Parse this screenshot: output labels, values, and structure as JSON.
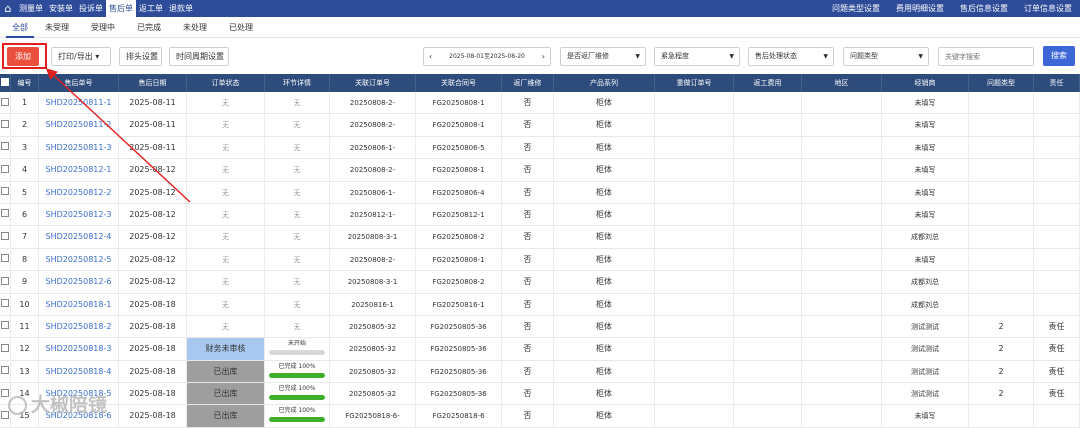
{
  "topnav": {
    "items": [
      "测量单",
      "安装单",
      "投诉单",
      "售后单",
      "返工单",
      "退款单"
    ],
    "active_index": 3,
    "right": [
      "问题类型设置",
      "费用明细设置",
      "售后信息设置",
      "订单信息设置"
    ]
  },
  "status_tabs": [
    "全部",
    "未受理",
    "受理中",
    "已完成",
    "未处理",
    "已处理"
  ],
  "toolbar": {
    "add": "添加",
    "print": "打印/导出",
    "col_setting": "排头设置",
    "time_setting": "时间周期设置",
    "date_range": "2025-08-01至2025-08-20",
    "filters": [
      "是否返厂维修",
      "紧急程度",
      "售后处理状态",
      "问题类型"
    ],
    "search_placeholder": "关键字搜索",
    "search_btn": "搜索"
  },
  "table": {
    "headers": [
      "编号",
      "售后单号",
      "售后日期",
      "订单状态",
      "环节详情",
      "关联订单号",
      "关联合同号",
      "返厂维修",
      "产品系列",
      "重做订单号",
      "返工费用",
      "地区",
      "经销商",
      "问题类型",
      "责任"
    ],
    "rows": [
      {
        "no": "1",
        "code": "SHD20250811-1",
        "date": "2025-08-11",
        "status": "无",
        "detail": "无",
        "order": "20250808-2-",
        "contract": "FG20250808-1",
        "ret": "否",
        "series": "柜体",
        "dealer": "未填写",
        "issue": "",
        "resp": ""
      },
      {
        "no": "2",
        "code": "SHD20250811-2",
        "date": "2025-08-11",
        "status": "无",
        "detail": "无",
        "order": "20250808-2-",
        "contract": "FG20250808-1",
        "ret": "否",
        "series": "柜体",
        "dealer": "未填写",
        "issue": "",
        "resp": ""
      },
      {
        "no": "3",
        "code": "SHD20250811-3",
        "date": "2025-08-11",
        "status": "无",
        "detail": "无",
        "order": "20250806-1-",
        "contract": "FG20250806-5",
        "ret": "否",
        "series": "柜体",
        "dealer": "未填写",
        "issue": "",
        "resp": ""
      },
      {
        "no": "4",
        "code": "SHD20250812-1",
        "date": "2025-08-12",
        "status": "无",
        "detail": "无",
        "order": "20250808-2-",
        "contract": "FG20250808-1",
        "ret": "否",
        "series": "柜体",
        "dealer": "未填写",
        "issue": "",
        "resp": ""
      },
      {
        "no": "5",
        "code": "SHD20250812-2",
        "date": "2025-08-12",
        "status": "无",
        "detail": "无",
        "order": "20250806-1-",
        "contract": "FG20250806-4",
        "ret": "否",
        "series": "柜体",
        "dealer": "未填写",
        "issue": "",
        "resp": ""
      },
      {
        "no": "6",
        "code": "SHD20250812-3",
        "date": "2025-08-12",
        "status": "无",
        "detail": "无",
        "order": "20250812-1-",
        "contract": "FG20250812-1",
        "ret": "否",
        "series": "柜体",
        "dealer": "未填写",
        "issue": "",
        "resp": ""
      },
      {
        "no": "7",
        "code": "SHD20250812-4",
        "date": "2025-08-12",
        "status": "无",
        "detail": "无",
        "order": "20250808-3-1",
        "contract": "FG20250808-2",
        "ret": "否",
        "series": "柜体",
        "dealer": "成都刘总",
        "issue": "",
        "resp": ""
      },
      {
        "no": "8",
        "code": "SHD20250812-5",
        "date": "2025-08-12",
        "status": "无",
        "detail": "无",
        "order": "20250808-2-",
        "contract": "FG20250808-1",
        "ret": "否",
        "series": "柜体",
        "dealer": "未填写",
        "issue": "",
        "resp": ""
      },
      {
        "no": "9",
        "code": "SHD20250812-6",
        "date": "2025-08-12",
        "status": "无",
        "detail": "无",
        "order": "20250808-3-1",
        "contract": "FG20250808-2",
        "ret": "否",
        "series": "柜体",
        "dealer": "成都刘总",
        "issue": "",
        "resp": ""
      },
      {
        "no": "10",
        "code": "SHD20250818-1",
        "date": "2025-08-18",
        "status": "无",
        "detail": "无",
        "order": "20250816-1",
        "contract": "FG20250816-1",
        "ret": "否",
        "series": "柜体",
        "dealer": "成都刘总",
        "issue": "",
        "resp": ""
      },
      {
        "no": "11",
        "code": "SHD20250818-2",
        "date": "2025-08-18",
        "status": "无",
        "detail": "无",
        "order": "20250805-32",
        "contract": "FG20250805-36",
        "ret": "否",
        "series": "柜体",
        "dealer": "测试测试",
        "issue": "2",
        "resp": "责任"
      },
      {
        "no": "12",
        "code": "SHD20250818-3",
        "date": "2025-08-18",
        "status": "财务未审核",
        "detail": "未开始",
        "progress": 0,
        "order": "20250805-32",
        "contract": "FG20250805-36",
        "ret": "否",
        "series": "柜体",
        "dealer": "测试测试",
        "issue": "2",
        "resp": "责任"
      },
      {
        "no": "13",
        "code": "SHD20250818-4",
        "date": "2025-08-18",
        "status": "已出库",
        "detail": "已完成 100%",
        "progress": 100,
        "order": "20250805-32",
        "contract": "FG20250805-36",
        "ret": "否",
        "series": "柜体",
        "dealer": "测试测试",
        "issue": "2",
        "resp": "责任"
      },
      {
        "no": "14",
        "code": "SHD20250818-5",
        "date": "2025-08-18",
        "status": "已出库",
        "detail": "已完成 100%",
        "progress": 100,
        "order": "20250805-32",
        "contract": "FG20250805-36",
        "ret": "否",
        "series": "柜体",
        "dealer": "测试测试",
        "issue": "2",
        "resp": "责任"
      },
      {
        "no": "15",
        "code": "SHD20250818-6",
        "date": "2025-08-18",
        "status": "已出库",
        "detail": "已完成 100%",
        "progress": 100,
        "order": "FG20250818-6-",
        "contract": "FG20250818-6",
        "ret": "否",
        "series": "柜体",
        "dealer": "未填写",
        "issue": "",
        "resp": ""
      }
    ]
  },
  "watermark": "大椒陪镜",
  "colors": {
    "topbar": "#2d4b99",
    "header": "#2d4b7b",
    "add_button": "#e94f3c",
    "search_button": "#3d66d6",
    "link": "#3a6ed0",
    "progress": "#3fae2a"
  }
}
